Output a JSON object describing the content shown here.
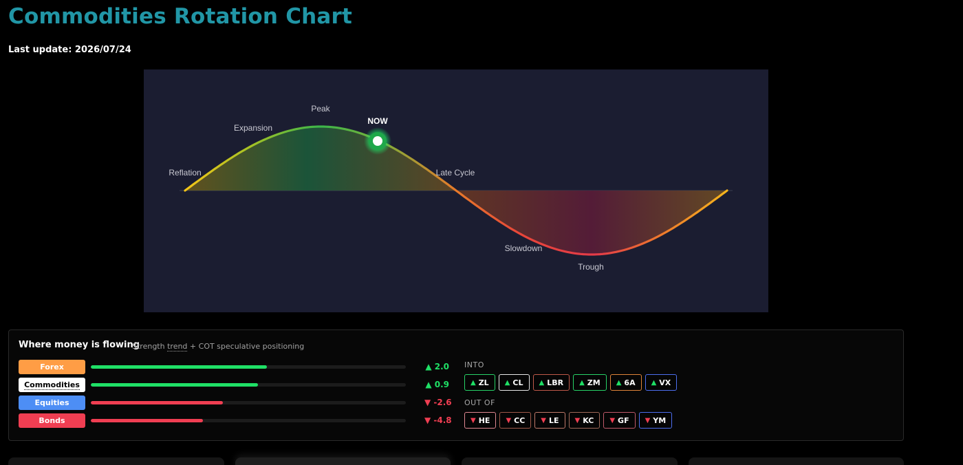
{
  "page": {
    "title": "Commodities Rotation Chart",
    "last_update": "Last update: 2026/07/24"
  },
  "chart_data": {
    "type": "line",
    "stages": [
      "Reflation",
      "Expansion",
      "Peak",
      "Late Cycle",
      "Slowdown",
      "Trough"
    ],
    "current_marker_label": "NOW",
    "current_stage_between": [
      "Peak",
      "Late Cycle"
    ]
  },
  "flow": {
    "heading": "Where money is flowing",
    "subtitle_pre": "Strength ",
    "subtitle_term": "trend",
    "subtitle_post": " + COT speculative positioning",
    "assets": [
      {
        "label": "Forex",
        "value": "▲ 2.0",
        "strength": 0.56,
        "direction": "up",
        "color": "#ff9d45"
      },
      {
        "label": "Commodities",
        "value": "▲ 0.9",
        "strength": 0.53,
        "direction": "up",
        "color": "#ffffff"
      },
      {
        "label": "Equities",
        "value": "▼ -2.6",
        "strength": 0.42,
        "direction": "down",
        "color": "#4d8ef5"
      },
      {
        "label": "Bonds",
        "value": "▼ -4.8",
        "strength": 0.355,
        "direction": "down",
        "color": "#f03e52"
      }
    ],
    "into_label": "INTO",
    "into": [
      {
        "symbol": "ZL",
        "border": "#27d468"
      },
      {
        "symbol": "CL",
        "border": "#e8e8e8"
      },
      {
        "symbol": "LBR",
        "border": "#c05a4a"
      },
      {
        "symbol": "ZM",
        "border": "#27d468"
      },
      {
        "symbol": "6A",
        "border": "#e0843a"
      },
      {
        "symbol": "VX",
        "border": "#4d6ff0"
      }
    ],
    "out_label": "OUT OF",
    "out_of": [
      {
        "symbol": "HE",
        "border": "#e08892"
      },
      {
        "symbol": "CC",
        "border": "#a05a4a"
      },
      {
        "symbol": "LE",
        "border": "#c07a6a"
      },
      {
        "symbol": "KC",
        "border": "#a06a5a"
      },
      {
        "symbol": "GF",
        "border": "#c05a6a"
      },
      {
        "symbol": "YM",
        "border": "#4d6ff0"
      }
    ],
    "colors": {
      "up": "#1fe066",
      "down": "#f03e52",
      "bar_up": "#1fe066",
      "bar_down": "#f03e52"
    }
  }
}
